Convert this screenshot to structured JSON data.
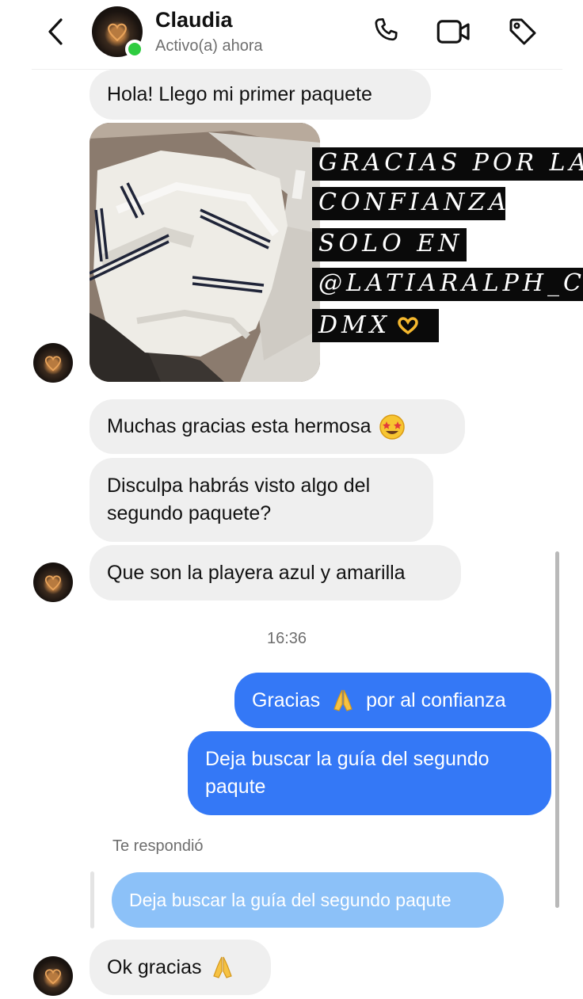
{
  "header": {
    "contact_name": "Claudia",
    "status": "Activo(a) ahora",
    "online_color": "#2ecc40",
    "icons": [
      "chevron-left-icon",
      "phone-icon",
      "video-camera-icon",
      "tag-icon"
    ]
  },
  "messages": {
    "m1": "Hola! Llego mi primer paquete",
    "caption": [
      "GRACIAS POR LA",
      "CONFIANZA",
      "SOLO EN",
      "@LATIARALPH_C",
      "DMX"
    ],
    "m2": "Muchas gracias esta hermosa",
    "m3_line1": "Disculpa habrás visto algo del",
    "m3_line2": "segundo paquete?",
    "m4": "Que son la playera azul y amarilla",
    "timestamp": "16:36",
    "o1_before": "Gracias",
    "o1_after": "por al confianza",
    "o2_line1": "Deja buscar la guía del segundo",
    "o2_line2": "paqute",
    "reply_label": "Te respondió",
    "reply_quote": "Deja buscar la guía del segundo paqute",
    "m5": "Ok gracias"
  },
  "colors": {
    "outgoing_bubble": "#3478f6",
    "incoming_bubble": "#efefef",
    "quoted_reply": "#8cc1f8"
  }
}
